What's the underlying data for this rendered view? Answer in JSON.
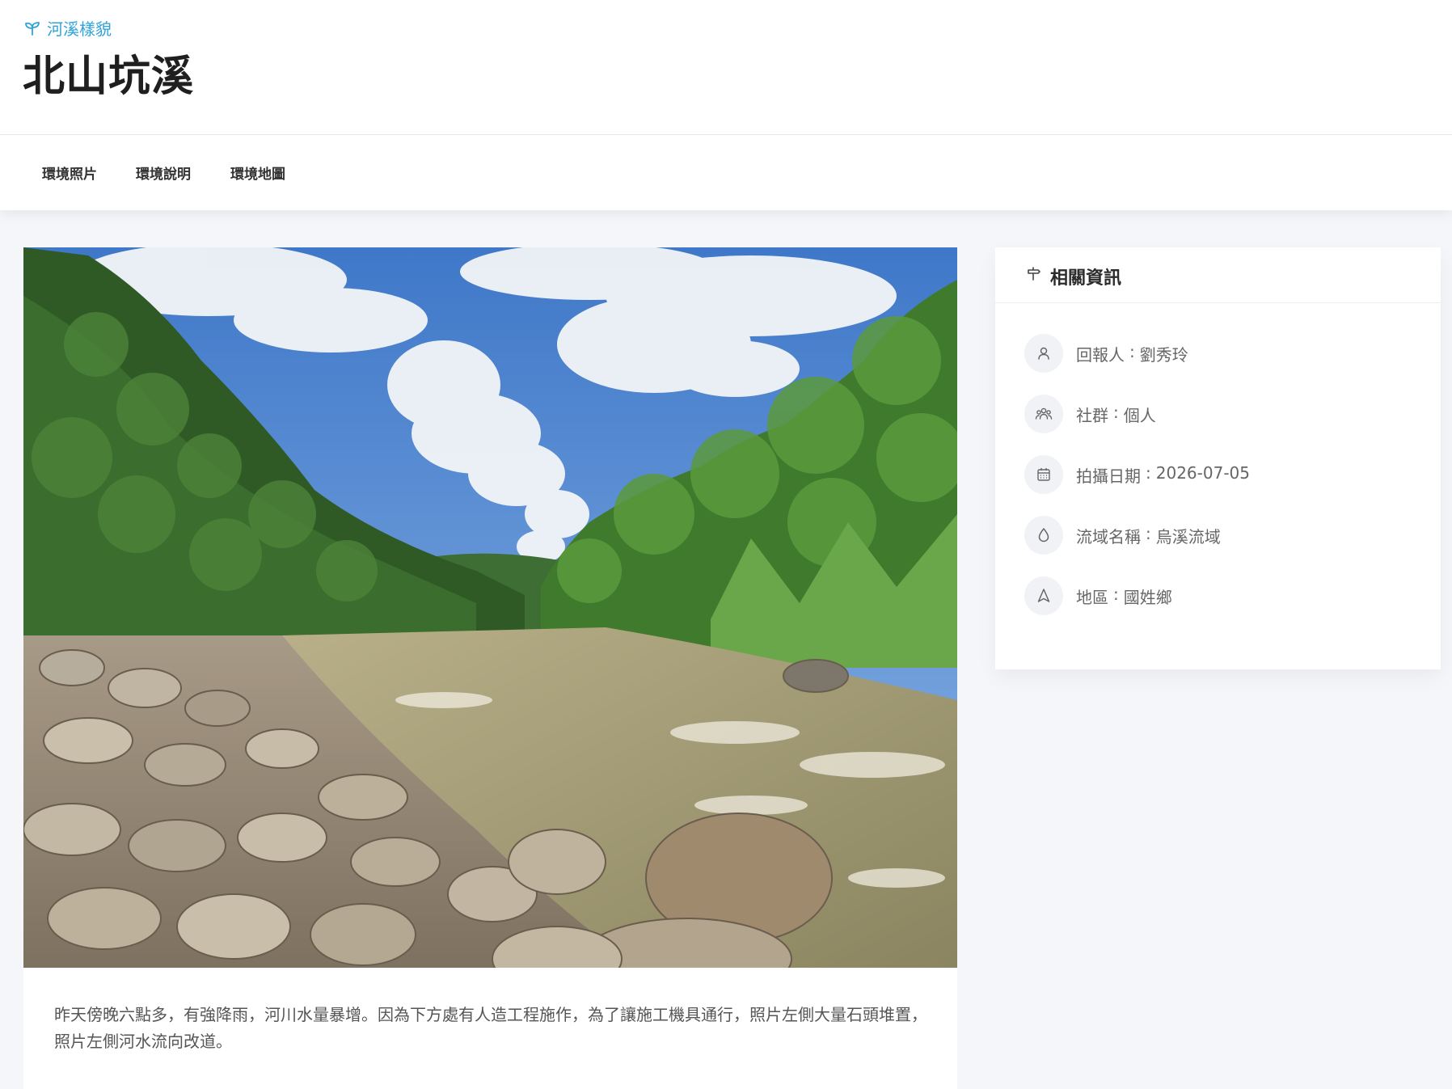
{
  "header": {
    "category_icon": "sprout-icon",
    "category": "河溪樣貌",
    "title": "北山坑溪",
    "accent_color": "#2fa3d8"
  },
  "tabs": [
    {
      "label": "環境照片"
    },
    {
      "label": "環境說明"
    },
    {
      "label": "環境地圖"
    }
  ],
  "photo": {
    "description": "昨天傍晚六點多，有強降雨，河川水量暴增。因為下方處有人造工程施作，為了讓施工機具通行，照片左側大量石頭堆置，照片左側河水流向改道。"
  },
  "info": {
    "title_icon": "signpost-icon",
    "title": "相關資訊",
    "rows": [
      {
        "icon": "user-icon",
        "label": "回報人",
        "sep": ":",
        "value": "劉秀玲"
      },
      {
        "icon": "group-icon",
        "label": "社群",
        "sep": ":",
        "value": "個人"
      },
      {
        "icon": "calendar-icon",
        "label": "拍攝日期",
        "sep": ":",
        "value": "2026-07-05"
      },
      {
        "icon": "droplet-icon",
        "label": "流域名稱",
        "sep": ":",
        "value": "烏溪流域"
      },
      {
        "icon": "navigation-icon",
        "label": "地區",
        "sep": ":",
        "value": "國姓鄉"
      }
    ]
  }
}
